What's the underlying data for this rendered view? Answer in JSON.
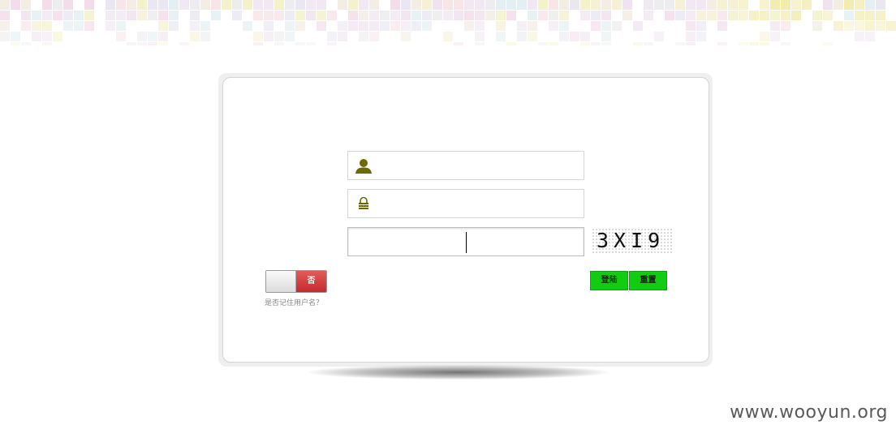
{
  "login": {
    "username": {
      "icon": "user-icon",
      "value": "",
      "placeholder": ""
    },
    "password": {
      "icon": "lock-icon",
      "value": "",
      "placeholder": ""
    },
    "captcha": {
      "value": "",
      "image_text": "3XI9"
    }
  },
  "remember": {
    "toggle_state_label": "否",
    "label": "是否记住用户名？"
  },
  "buttons": {
    "login": "登陆",
    "reset": "重置"
  },
  "watermark": "www.wooyun.org",
  "colors": {
    "button_green": "#11cc11",
    "toggle_red": "#d23a3a",
    "icon_olive": "#6b6b00"
  }
}
